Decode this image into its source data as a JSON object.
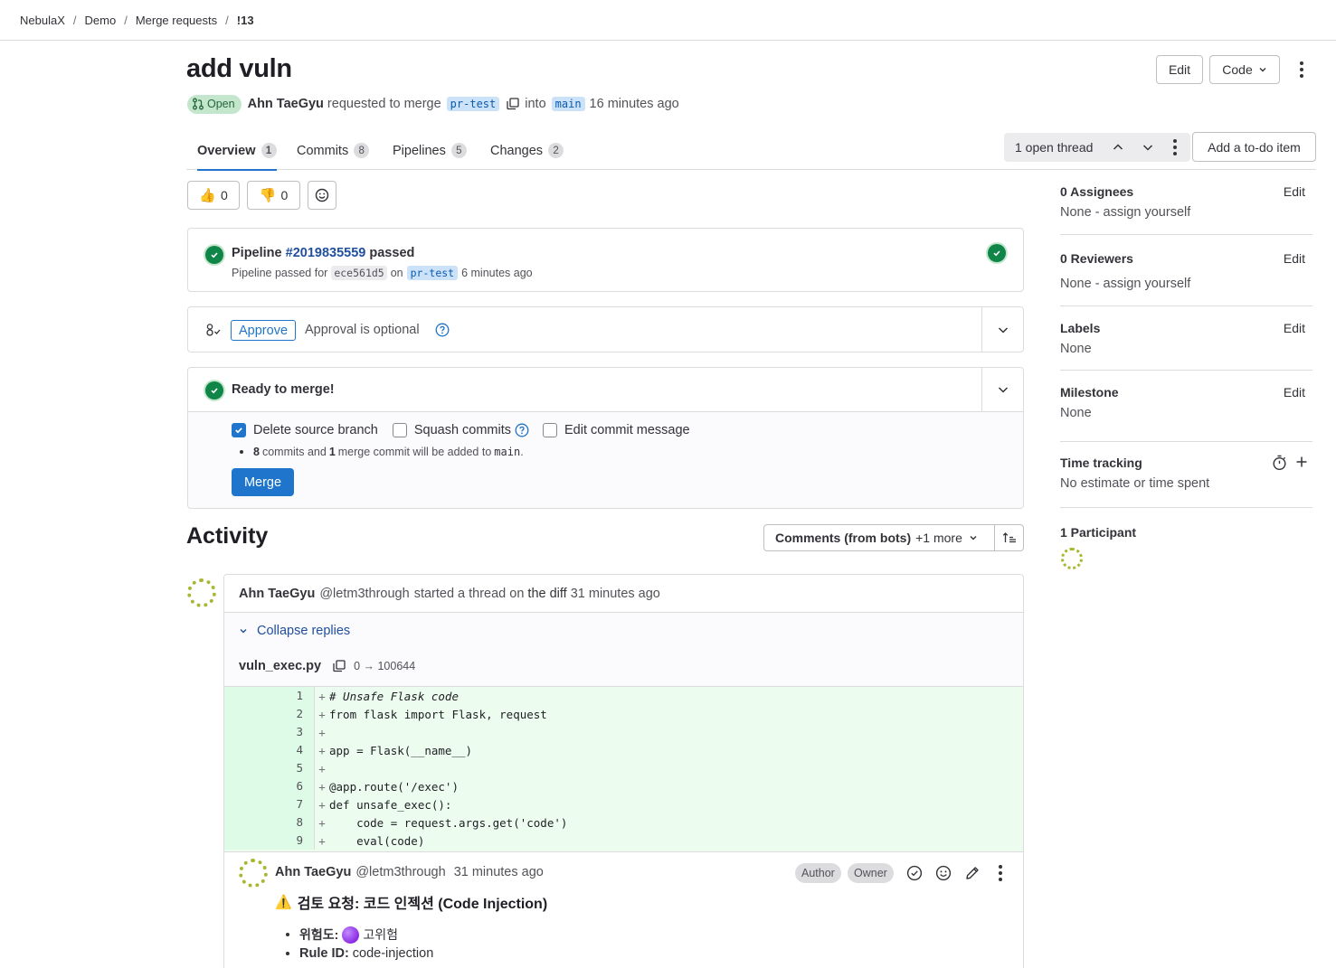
{
  "breadcrumb": {
    "items": [
      "NebulaX",
      "Demo",
      "Merge requests"
    ],
    "current": "!13",
    "separator": "/"
  },
  "header": {
    "title": "add vuln",
    "edit_label": "Edit",
    "code_label": "Code",
    "status": "Open",
    "author": "Ahn TaeGyu",
    "requested_text": "requested to merge",
    "source_branch": "pr-test",
    "into_text": "into",
    "target_branch": "main",
    "time_ago": "16 minutes ago"
  },
  "tabs": [
    {
      "label": "Overview",
      "count": "1"
    },
    {
      "label": "Commits",
      "count": "8"
    },
    {
      "label": "Pipelines",
      "count": "5"
    },
    {
      "label": "Changes",
      "count": "2"
    }
  ],
  "threads_nav": {
    "label": "1 open thread"
  },
  "todo_label": "Add a to-do item",
  "reactions": {
    "thumbs_up": "0",
    "thumbs_down": "0"
  },
  "pipeline": {
    "prefix": "Pipeline",
    "id": "#2019835559",
    "status_word": "passed",
    "detail_prefix": "Pipeline passed for",
    "commit": "ece561d5",
    "on_text": "on",
    "branch": "pr-test",
    "time_ago": "6 minutes ago"
  },
  "approval": {
    "button": "Approve",
    "text": "Approval is optional"
  },
  "merge": {
    "title": "Ready to merge!",
    "delete_branch": "Delete source branch",
    "squash": "Squash commits",
    "edit_msg": "Edit commit message",
    "commits_count": "8",
    "commits_text1": "commits and",
    "merge_count": "1",
    "commits_text2": "merge commit will be added to",
    "target": "main",
    "period": ".",
    "button": "Merge"
  },
  "activity": {
    "title": "Activity",
    "filter_label": "Comments (from bots)",
    "filter_more": "+1 more"
  },
  "thread": {
    "author": "Ahn TaeGyu",
    "handle": "@letm3through",
    "started_text": "started a thread on",
    "the_diff": "the diff",
    "time_ago": "31 minutes ago",
    "collapse_label": "Collapse replies",
    "file_name": "vuln_exec.py",
    "file_mode": "0 → 100644",
    "diff_lines": [
      {
        "n": "1",
        "text": "# Unsafe Flask code"
      },
      {
        "n": "2",
        "text": "from flask import Flask, request"
      },
      {
        "n": "3",
        "text": ""
      },
      {
        "n": "4",
        "text": "app = Flask(__name__)"
      },
      {
        "n": "5",
        "text": ""
      },
      {
        "n": "6",
        "text": "@app.route('/exec')"
      },
      {
        "n": "7",
        "text": "def unsafe_exec():"
      },
      {
        "n": "8",
        "text": "    code = request.args.get('code')"
      },
      {
        "n": "9",
        "text": "    eval(code)"
      }
    ]
  },
  "note": {
    "author": "Ahn TaeGyu",
    "handle": "@letm3through",
    "time_ago": "31 minutes ago",
    "badge_author": "Author",
    "badge_owner": "Owner",
    "warning_emoji": "⚠️",
    "heading": "검토 요청: 코드 인젝션 (Code Injection)",
    "risk_label": "위험도:",
    "risk_value": "고위험",
    "rule_label": "Rule ID:",
    "rule_value": "code-injection"
  },
  "sidebar": {
    "assignees": {
      "title": "0 Assignees",
      "edit": "Edit",
      "value": "None - assign yourself"
    },
    "reviewers": {
      "title": "0 Reviewers",
      "edit": "Edit",
      "value": "None - assign yourself"
    },
    "labels": {
      "title": "Labels",
      "edit": "Edit",
      "value": "None"
    },
    "milestone": {
      "title": "Milestone",
      "edit": "Edit",
      "value": "None"
    },
    "time_tracking": {
      "title": "Time tracking",
      "value": "No estimate or time spent"
    },
    "participants": {
      "title": "1 Participant"
    }
  },
  "colors": {
    "accent": "#1f75cb",
    "success": "#108548",
    "diff_added": "#ecfdf0",
    "avatar": "#a9b730"
  }
}
